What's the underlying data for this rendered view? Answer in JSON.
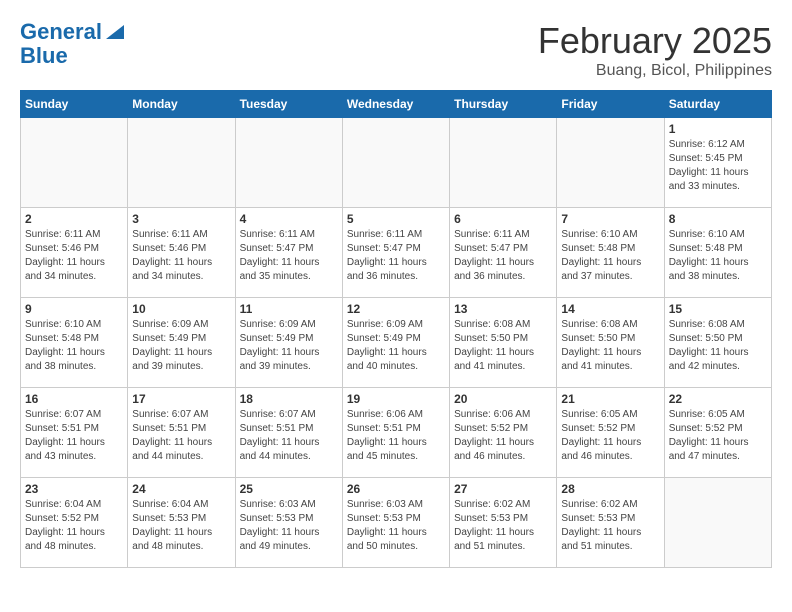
{
  "header": {
    "logo_line1": "General",
    "logo_line2": "Blue",
    "month": "February 2025",
    "location": "Buang, Bicol, Philippines"
  },
  "weekdays": [
    "Sunday",
    "Monday",
    "Tuesday",
    "Wednesday",
    "Thursday",
    "Friday",
    "Saturday"
  ],
  "weeks": [
    [
      {
        "day": "",
        "detail": ""
      },
      {
        "day": "",
        "detail": ""
      },
      {
        "day": "",
        "detail": ""
      },
      {
        "day": "",
        "detail": ""
      },
      {
        "day": "",
        "detail": ""
      },
      {
        "day": "",
        "detail": ""
      },
      {
        "day": "1",
        "detail": "Sunrise: 6:12 AM\nSunset: 5:45 PM\nDaylight: 11 hours\nand 33 minutes."
      }
    ],
    [
      {
        "day": "2",
        "detail": "Sunrise: 6:11 AM\nSunset: 5:46 PM\nDaylight: 11 hours\nand 34 minutes."
      },
      {
        "day": "3",
        "detail": "Sunrise: 6:11 AM\nSunset: 5:46 PM\nDaylight: 11 hours\nand 34 minutes."
      },
      {
        "day": "4",
        "detail": "Sunrise: 6:11 AM\nSunset: 5:47 PM\nDaylight: 11 hours\nand 35 minutes."
      },
      {
        "day": "5",
        "detail": "Sunrise: 6:11 AM\nSunset: 5:47 PM\nDaylight: 11 hours\nand 36 minutes."
      },
      {
        "day": "6",
        "detail": "Sunrise: 6:11 AM\nSunset: 5:47 PM\nDaylight: 11 hours\nand 36 minutes."
      },
      {
        "day": "7",
        "detail": "Sunrise: 6:10 AM\nSunset: 5:48 PM\nDaylight: 11 hours\nand 37 minutes."
      },
      {
        "day": "8",
        "detail": "Sunrise: 6:10 AM\nSunset: 5:48 PM\nDaylight: 11 hours\nand 38 minutes."
      }
    ],
    [
      {
        "day": "9",
        "detail": "Sunrise: 6:10 AM\nSunset: 5:48 PM\nDaylight: 11 hours\nand 38 minutes."
      },
      {
        "day": "10",
        "detail": "Sunrise: 6:09 AM\nSunset: 5:49 PM\nDaylight: 11 hours\nand 39 minutes."
      },
      {
        "day": "11",
        "detail": "Sunrise: 6:09 AM\nSunset: 5:49 PM\nDaylight: 11 hours\nand 39 minutes."
      },
      {
        "day": "12",
        "detail": "Sunrise: 6:09 AM\nSunset: 5:49 PM\nDaylight: 11 hours\nand 40 minutes."
      },
      {
        "day": "13",
        "detail": "Sunrise: 6:08 AM\nSunset: 5:50 PM\nDaylight: 11 hours\nand 41 minutes."
      },
      {
        "day": "14",
        "detail": "Sunrise: 6:08 AM\nSunset: 5:50 PM\nDaylight: 11 hours\nand 41 minutes."
      },
      {
        "day": "15",
        "detail": "Sunrise: 6:08 AM\nSunset: 5:50 PM\nDaylight: 11 hours\nand 42 minutes."
      }
    ],
    [
      {
        "day": "16",
        "detail": "Sunrise: 6:07 AM\nSunset: 5:51 PM\nDaylight: 11 hours\nand 43 minutes."
      },
      {
        "day": "17",
        "detail": "Sunrise: 6:07 AM\nSunset: 5:51 PM\nDaylight: 11 hours\nand 44 minutes."
      },
      {
        "day": "18",
        "detail": "Sunrise: 6:07 AM\nSunset: 5:51 PM\nDaylight: 11 hours\nand 44 minutes."
      },
      {
        "day": "19",
        "detail": "Sunrise: 6:06 AM\nSunset: 5:51 PM\nDaylight: 11 hours\nand 45 minutes."
      },
      {
        "day": "20",
        "detail": "Sunrise: 6:06 AM\nSunset: 5:52 PM\nDaylight: 11 hours\nand 46 minutes."
      },
      {
        "day": "21",
        "detail": "Sunrise: 6:05 AM\nSunset: 5:52 PM\nDaylight: 11 hours\nand 46 minutes."
      },
      {
        "day": "22",
        "detail": "Sunrise: 6:05 AM\nSunset: 5:52 PM\nDaylight: 11 hours\nand 47 minutes."
      }
    ],
    [
      {
        "day": "23",
        "detail": "Sunrise: 6:04 AM\nSunset: 5:52 PM\nDaylight: 11 hours\nand 48 minutes."
      },
      {
        "day": "24",
        "detail": "Sunrise: 6:04 AM\nSunset: 5:53 PM\nDaylight: 11 hours\nand 48 minutes."
      },
      {
        "day": "25",
        "detail": "Sunrise: 6:03 AM\nSunset: 5:53 PM\nDaylight: 11 hours\nand 49 minutes."
      },
      {
        "day": "26",
        "detail": "Sunrise: 6:03 AM\nSunset: 5:53 PM\nDaylight: 11 hours\nand 50 minutes."
      },
      {
        "day": "27",
        "detail": "Sunrise: 6:02 AM\nSunset: 5:53 PM\nDaylight: 11 hours\nand 51 minutes."
      },
      {
        "day": "28",
        "detail": "Sunrise: 6:02 AM\nSunset: 5:53 PM\nDaylight: 11 hours\nand 51 minutes."
      },
      {
        "day": "",
        "detail": ""
      }
    ]
  ]
}
